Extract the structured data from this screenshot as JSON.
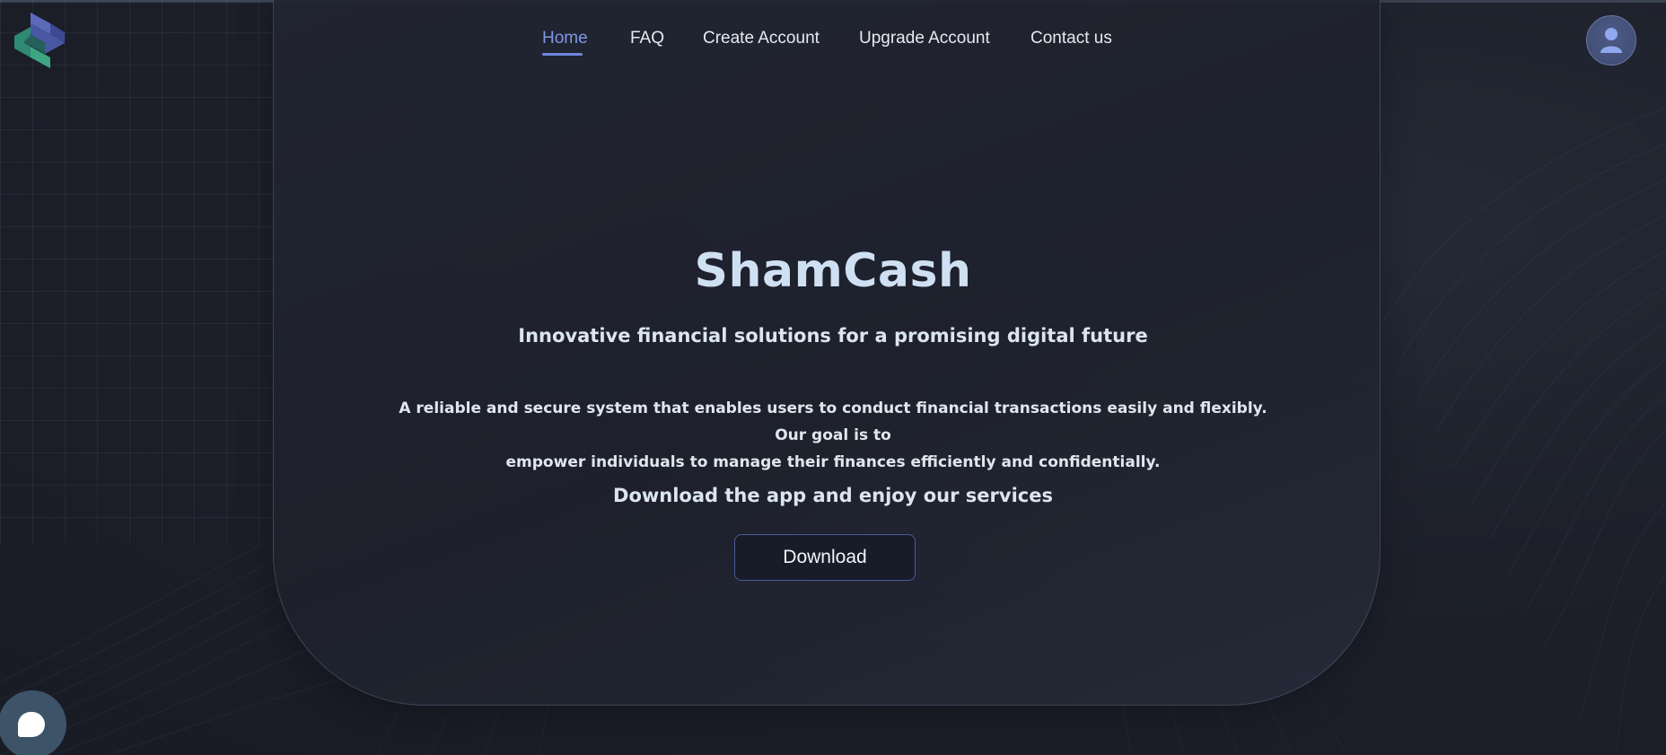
{
  "app": {
    "name": "ShamCash",
    "logo_icon": "shamcash-logo-icon"
  },
  "nav": {
    "items": [
      {
        "label": "Home",
        "active": true
      },
      {
        "label": "FAQ",
        "active": false
      },
      {
        "label": "Create Account",
        "active": false
      },
      {
        "label": "Upgrade Account",
        "active": false
      },
      {
        "label": "Contact us",
        "active": false
      }
    ],
    "accent_color": "#7f97e6"
  },
  "user": {
    "avatar_icon": "user-avatar-icon"
  },
  "hero": {
    "title": "ShamCash",
    "subtitle": "Innovative financial solutions for a promising digital future",
    "description_line1": "A reliable and secure system that enables users to conduct financial transactions easily and flexibly. Our goal is to",
    "description_line2": "empower individuals to manage their finances efficiently and confidentially.",
    "download_prompt": "Download the app and enjoy our services",
    "download_label": "Download"
  },
  "chat": {
    "icon": "chat-bubble-icon"
  },
  "colors": {
    "background": "#1b1d27",
    "title": "#cfe0f3",
    "button_border": "#4a5a98",
    "chat_button": "#3c5368"
  }
}
